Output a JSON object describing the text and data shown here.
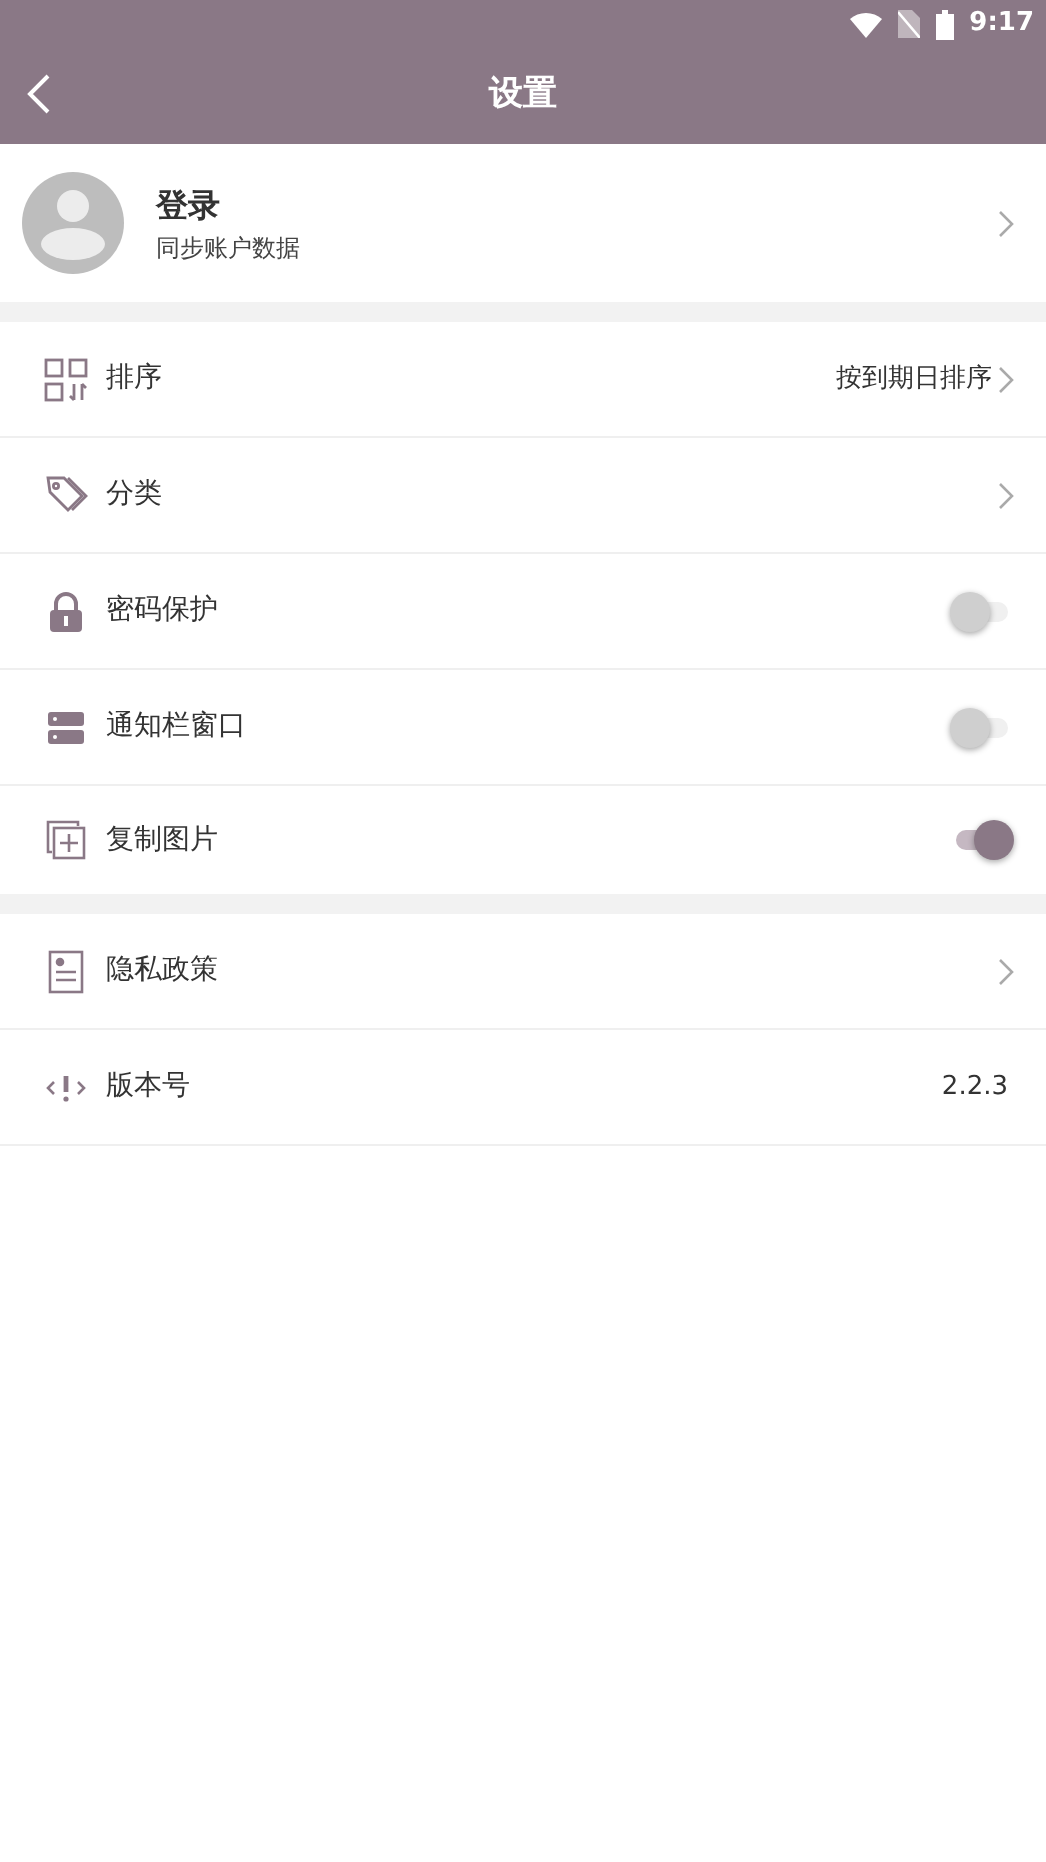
{
  "status_bar": {
    "time": "9:17"
  },
  "toolbar": {
    "title": "设置"
  },
  "account": {
    "title": "登录",
    "subtitle": "同步账户数据"
  },
  "sections": [
    {
      "items": [
        {
          "kind": "link",
          "label": "排序",
          "value": "按到期日排序"
        },
        {
          "kind": "link",
          "label": "分类"
        },
        {
          "kind": "toggle",
          "label": "密码保护",
          "on": false
        },
        {
          "kind": "toggle",
          "label": "通知栏窗口",
          "on": false
        },
        {
          "kind": "toggle",
          "label": "复制图片",
          "on": true
        }
      ]
    },
    {
      "items": [
        {
          "kind": "link",
          "label": "隐私政策"
        },
        {
          "kind": "info",
          "label": "版本号",
          "value": "2.2.3"
        }
      ]
    }
  ]
}
